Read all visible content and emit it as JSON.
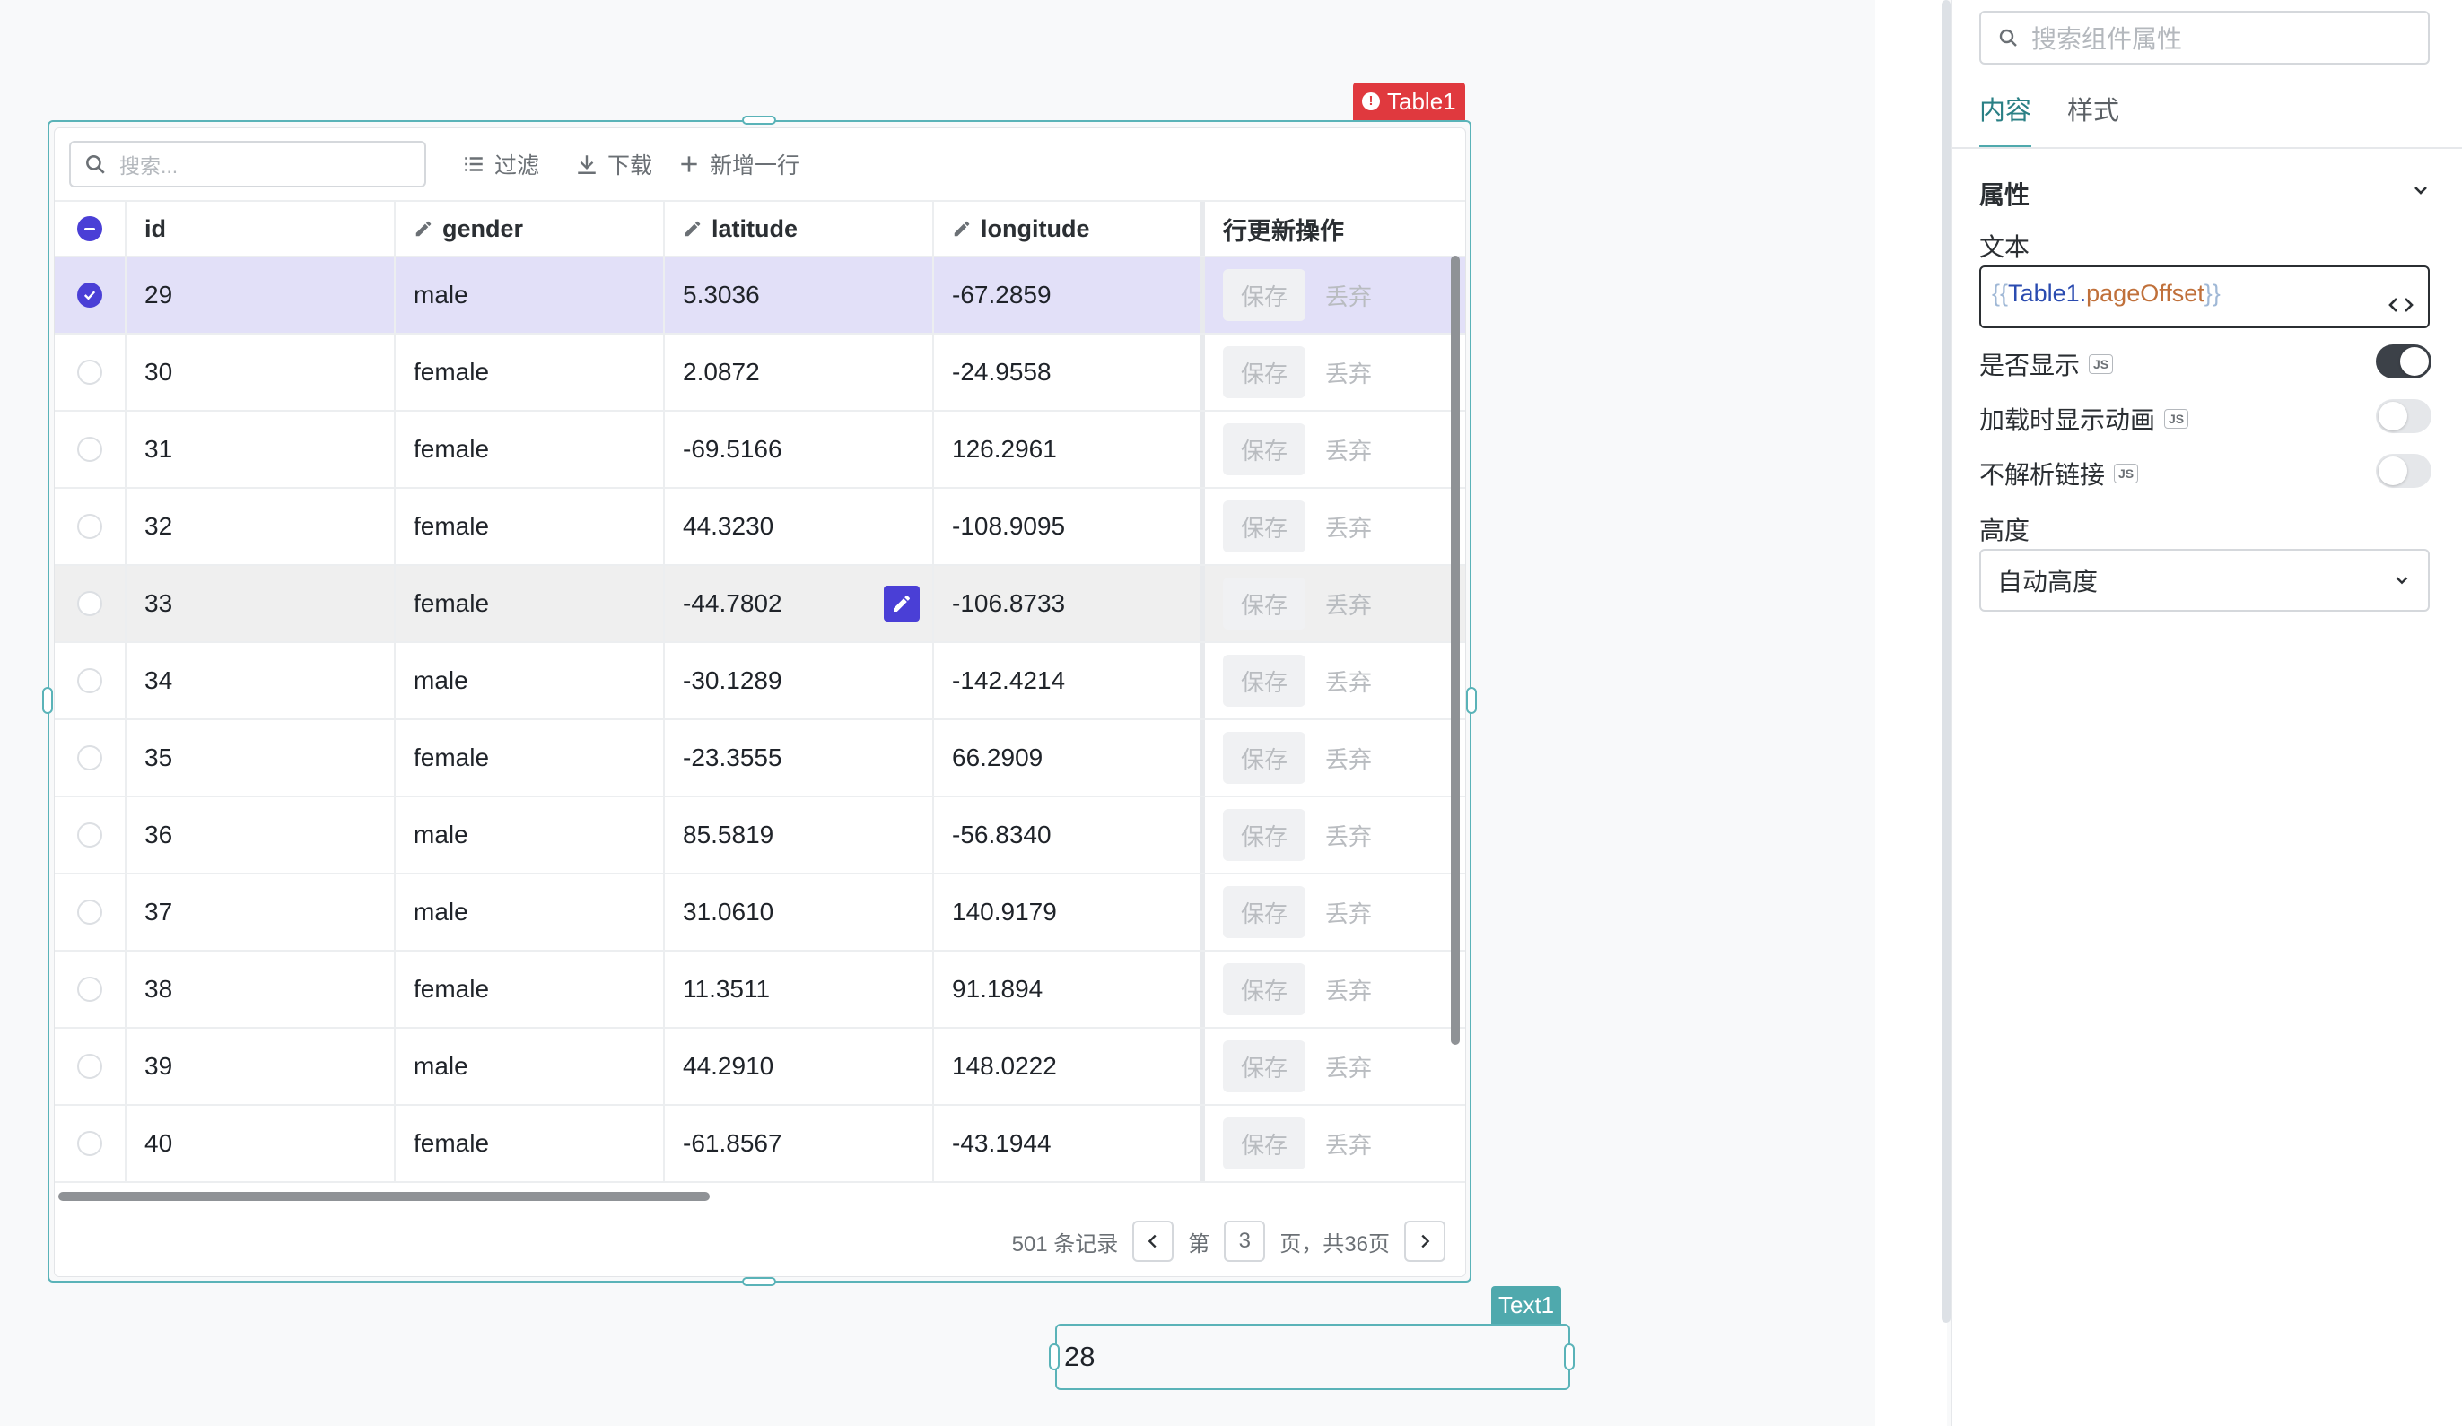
{
  "table": {
    "tag_label": "Table1",
    "toolbar": {
      "search_placeholder": "搜索...",
      "filter_label": "过滤",
      "download_label": "下载",
      "add_row_label": "新增一行"
    },
    "columns": [
      "id",
      "gender",
      "latitude",
      "longitude",
      "行更新操作"
    ],
    "rows": [
      {
        "id": "29",
        "gender": "male",
        "latitude": "5.3036",
        "longitude": "-67.2859"
      },
      {
        "id": "30",
        "gender": "female",
        "latitude": "2.0872",
        "longitude": "-24.9558"
      },
      {
        "id": "31",
        "gender": "female",
        "latitude": "-69.5166",
        "longitude": "126.2961"
      },
      {
        "id": "32",
        "gender": "female",
        "latitude": "44.3230",
        "longitude": "-108.9095"
      },
      {
        "id": "33",
        "gender": "female",
        "latitude": "-44.7802",
        "longitude": "-106.8733"
      },
      {
        "id": "34",
        "gender": "male",
        "latitude": "-30.1289",
        "longitude": "-142.4214"
      },
      {
        "id": "35",
        "gender": "female",
        "latitude": "-23.3555",
        "longitude": "66.2909"
      },
      {
        "id": "36",
        "gender": "male",
        "latitude": "85.5819",
        "longitude": "-56.8340"
      },
      {
        "id": "37",
        "gender": "male",
        "latitude": "31.0610",
        "longitude": "140.9179"
      },
      {
        "id": "38",
        "gender": "female",
        "latitude": "11.3511",
        "longitude": "91.1894"
      },
      {
        "id": "39",
        "gender": "male",
        "latitude": "44.2910",
        "longitude": "148.0222"
      },
      {
        "id": "40",
        "gender": "female",
        "latitude": "-61.8567",
        "longitude": "-43.1944"
      }
    ],
    "selected_row_index": 0,
    "hovered_row_index": 4,
    "row_action_save": "保存",
    "row_action_discard": "丢弃",
    "pager": {
      "total_label": "501 条记录",
      "page_prefix": "第",
      "current_page": "3",
      "page_suffix": "页，共36页"
    }
  },
  "text_component": {
    "tag_label": "Text1",
    "value": "28"
  },
  "panel": {
    "search_placeholder": "搜索组件属性",
    "tabs": [
      "内容",
      "样式"
    ],
    "active_tab": "内容",
    "section_title": "属性",
    "text_label": "文本",
    "text_binding": {
      "open": "{{",
      "object": "Table1",
      "dot": ".",
      "property": "pageOffset",
      "close": "}}"
    },
    "visible_label": "是否显示",
    "visible_on": true,
    "loading_label": "加载时显示动画",
    "loading_on": false,
    "no_parse_label": "不解析链接",
    "no_parse_on": false,
    "js_badge": "JS",
    "height_label": "高度",
    "height_value": "自动高度"
  },
  "colors": {
    "accent": "#4a3fd6",
    "frame": "#5ab3b8",
    "table_tag": "#e0393e",
    "text_tag": "#4fa9ad"
  }
}
